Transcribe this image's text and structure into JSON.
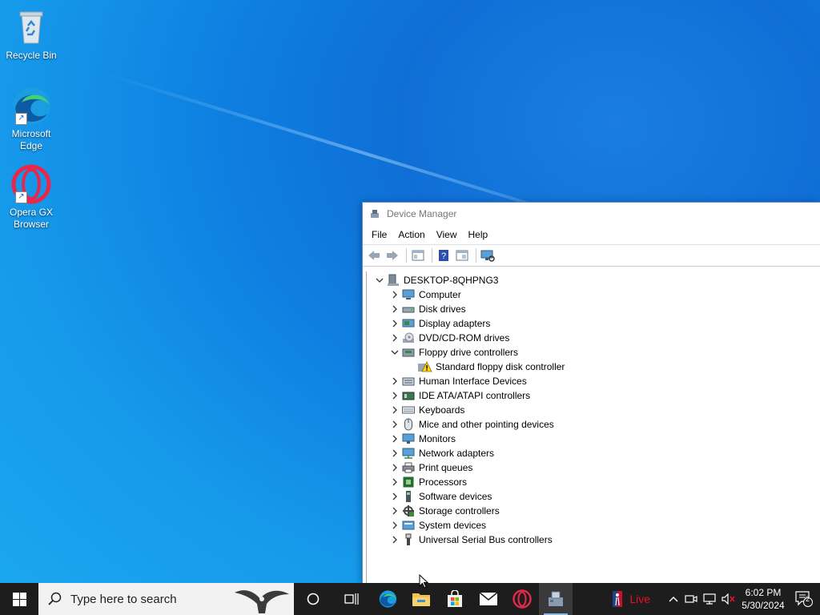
{
  "desktop": {
    "icons": [
      {
        "label": "Recycle Bin"
      },
      {
        "label": "Microsoft Edge"
      },
      {
        "label": "Opera GX Browser"
      }
    ]
  },
  "window": {
    "title": "Device Manager",
    "menu": [
      "File",
      "Action",
      "View",
      "Help"
    ],
    "toolbar": [
      "back-icon",
      "forward-icon",
      "properties-icon",
      "help-icon",
      "update-driver-icon",
      "scan-hardware-icon"
    ],
    "tree": {
      "root": "DESKTOP-8QHPNG3",
      "items": [
        {
          "label": "Computer",
          "icon": "computer-icon",
          "expanded": false
        },
        {
          "label": "Disk drives",
          "icon": "disk-icon",
          "expanded": false
        },
        {
          "label": "Display adapters",
          "icon": "display-icon",
          "expanded": false
        },
        {
          "label": "DVD/CD-ROM drives",
          "icon": "dvd-icon",
          "expanded": false
        },
        {
          "label": "Floppy drive controllers",
          "icon": "floppy-icon",
          "expanded": true,
          "children": [
            {
              "label": "Standard floppy disk controller",
              "icon": "warning-icon"
            }
          ]
        },
        {
          "label": "Human Interface Devices",
          "icon": "hid-icon",
          "expanded": false
        },
        {
          "label": "IDE ATA/ATAPI controllers",
          "icon": "ide-icon",
          "expanded": false
        },
        {
          "label": "Keyboards",
          "icon": "keyboard-icon",
          "expanded": false
        },
        {
          "label": "Mice and other pointing devices",
          "icon": "mouse-icon",
          "expanded": false
        },
        {
          "label": "Monitors",
          "icon": "monitor-icon",
          "expanded": false
        },
        {
          "label": "Network adapters",
          "icon": "network-icon",
          "expanded": false
        },
        {
          "label": "Print queues",
          "icon": "printer-icon",
          "expanded": false
        },
        {
          "label": "Processors",
          "icon": "processor-icon",
          "expanded": false
        },
        {
          "label": "Software devices",
          "icon": "software-icon",
          "expanded": false
        },
        {
          "label": "Storage controllers",
          "icon": "storage-icon",
          "expanded": false
        },
        {
          "label": "System devices",
          "icon": "system-icon",
          "expanded": false
        },
        {
          "label": "Universal Serial Bus controllers",
          "icon": "usb-icon",
          "expanded": false
        }
      ]
    }
  },
  "taskbar": {
    "search_placeholder": "Type here to search",
    "apps": [
      "edge-icon",
      "file-explorer-icon",
      "store-icon",
      "mail-icon",
      "opera-icon",
      "device-manager-icon"
    ],
    "news_label": "Live",
    "time": "6:02 PM",
    "date": "5/30/2024",
    "notification_count": "2"
  },
  "colors": {
    "accent": "#0078d7",
    "taskbar": "#1d1d1d",
    "live": "#e81123"
  }
}
